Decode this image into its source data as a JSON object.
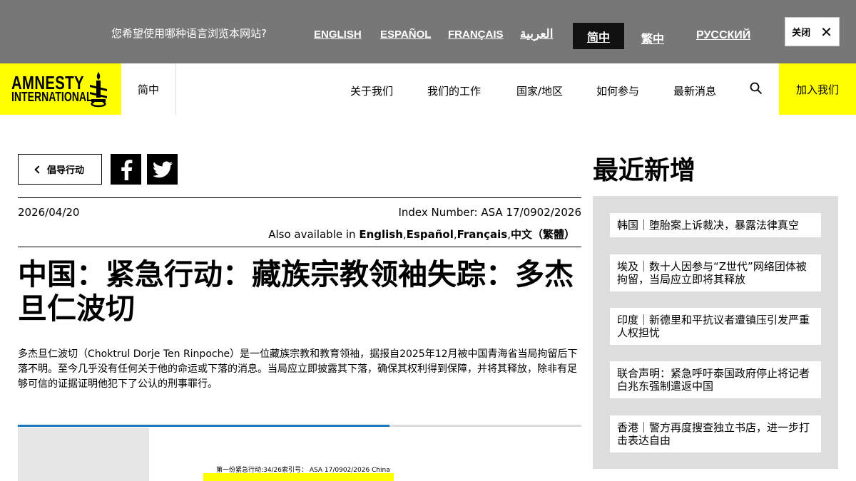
{
  "language_bar": {
    "question": "您希望使用哪种语言浏览本网站?",
    "languages": [
      "ENGLISH",
      "ESPAÑOL",
      "FRANÇAIS",
      "العربية",
      "简中",
      "繁中",
      "РУССКИЙ"
    ],
    "active_index": 4,
    "close_label": "关闭",
    "close_icon": "close-icon"
  },
  "header": {
    "logo_line1": "AMNESTY",
    "logo_line2": "INTERNATIONAL",
    "current_language": "简中",
    "nav": [
      "关于我们",
      "我们的工作",
      "国家/地区",
      "如何参与",
      "最新消息"
    ],
    "search_icon": "search-icon",
    "join_label": "加入我们",
    "brand_color": "#ffff00"
  },
  "article": {
    "back_label": "倡导行动",
    "share_icons": [
      "facebook-icon",
      "twitter-icon"
    ],
    "date": "2026/04/20",
    "index_number": "Index Number: ASA 17/0902/2026",
    "also_available_label": "Also available in",
    "also_available": [
      "English",
      "Español",
      "Français",
      "中文（繁體）"
    ],
    "title": "中国：紧急行动：藏族宗教领袖失踪：多杰旦仁波切",
    "summary": "多杰旦仁波切（Choktrul Dorje Ten Rinpoche）是一位藏族宗教和教育领袖，据报自2025年12月被中国青海省当局拘留后下落不明。至今几乎没有任何关于他的命运或下落的消息。当局应立即披露其下落，确保其权利得到保障，并将其释放，除非有足够可信的证据证明他犯下了公认的刑事罪行。",
    "read_progress": 0.66,
    "progress_color": "#1a78c2",
    "document_meta": "第一份紧急行动:34/26索引号： ASA 17/0902/2026 China"
  },
  "sidebar": {
    "title": "最近新增",
    "items": [
      "韩国｜堕胎案上诉裁决，暴露法律真空",
      "埃及｜数十人因参与“Z世代”网络团体被拘留，当局应立即将其释放",
      "印度｜新德里和平抗议者遭镇压引发严重人权担忧",
      "联合声明：紧急呼吁泰国政府停止将记者白兆东强制遣返中国",
      "香港｜警方再度搜查独立书店，进一步打击表达自由"
    ]
  }
}
